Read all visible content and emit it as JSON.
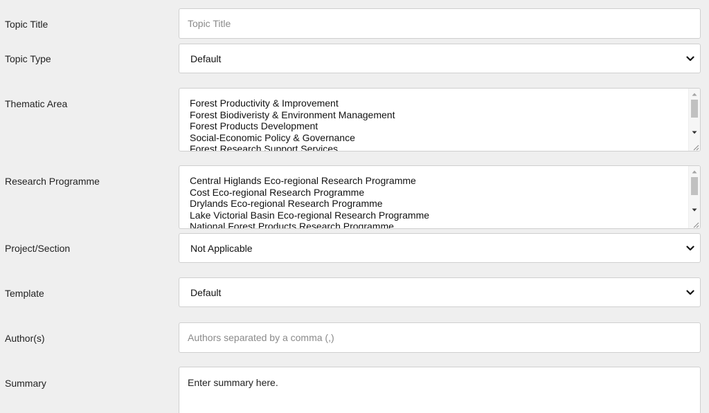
{
  "fields": {
    "topic_title": {
      "label": "Topic Title",
      "placeholder": "Topic Title"
    },
    "topic_type": {
      "label": "Topic Type",
      "selected": "Default"
    },
    "thematic_area": {
      "label": "Thematic Area",
      "options": [
        "Forest Productivity & Improvement",
        "Forest Biodiveristy & Environment Management",
        "Forest Products Development",
        "Social-Economic Policy & Governance",
        "Forest Research Support Services"
      ]
    },
    "research_programme": {
      "label": "Research Programme",
      "options": [
        "Central Higlands Eco-regional Research Programme",
        "Cost Eco-regional Research Programme",
        "Drylands Eco-regional Research Programme",
        "Lake Victorial Basin Eco-regional Research Programme",
        "National Forest Products Research Programme"
      ]
    },
    "project_section": {
      "label": "Project/Section",
      "selected": "Not Applicable"
    },
    "template": {
      "label": "Template",
      "selected": "Default"
    },
    "authors": {
      "label": "Author(s)",
      "placeholder": "Authors separated by a comma (,)"
    },
    "summary": {
      "label": "Summary",
      "value": "Enter summary here."
    }
  },
  "icons": {
    "select_chevron": "chevron-down-icon",
    "scroll_up": "triangle-up-icon",
    "scroll_down": "triangle-down-icon",
    "resize": "resize-grip-icon"
  }
}
